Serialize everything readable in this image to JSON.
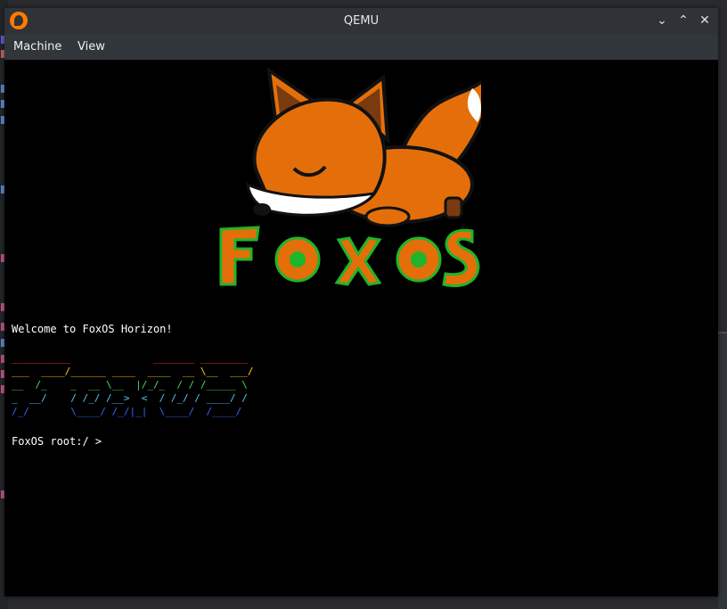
{
  "window": {
    "title": "QEMU",
    "buttons": {
      "minimize": "⌄",
      "maximize": "⌃",
      "close": "✕"
    }
  },
  "menu": {
    "items": [
      {
        "label": "Machine"
      },
      {
        "label": "View"
      }
    ]
  },
  "logo": {
    "text": "FOXOS"
  },
  "terminal": {
    "welcome": "Welcome to FoxOS Horizon!",
    "banner": [
      {
        "text": "__________              _______ ________",
        "color": "#ff3b30"
      },
      {
        "text": "___  ____/______ ____  ____  __ \\__  ___/",
        "color": "#ffd60a"
      },
      {
        "text": "__  /_    _  __ \\__  |/_/_  / / /_____ \\",
        "color": "#4cd964"
      },
      {
        "text": "_  __/    / /_/ /__>  <  / /_/ / ____/ /",
        "color": "#5ac8fa"
      },
      {
        "text": "/_/       \\____/ /_/|_|  \\____/  /____/",
        "color": "#3a66ff"
      }
    ],
    "prompt": "FoxOS root:/ >"
  },
  "colors": {
    "fox_orange": "#e46f0a",
    "outline_green": "#1fb52a",
    "terminal_bg": "#000000"
  }
}
